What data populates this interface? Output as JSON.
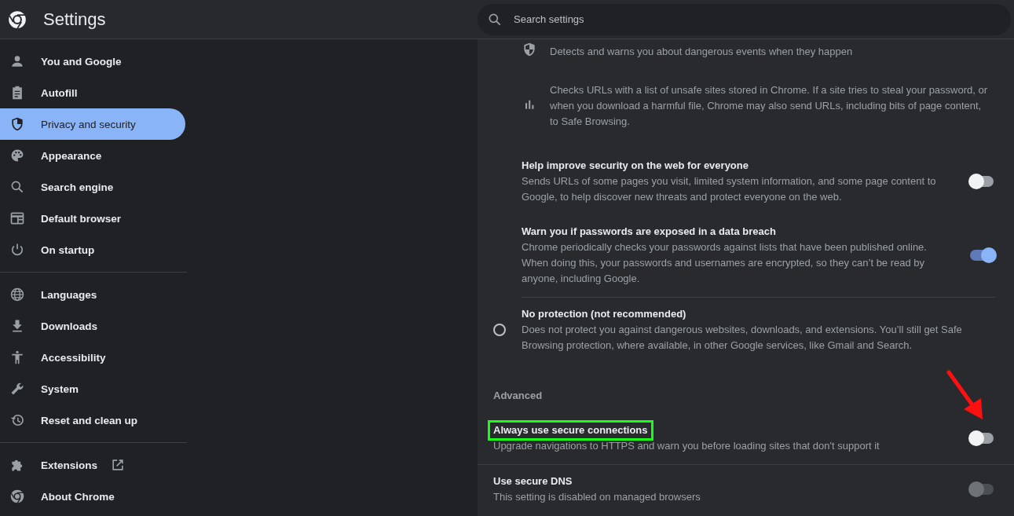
{
  "header": {
    "title": "Settings",
    "search": {
      "placeholder": "Search settings"
    }
  },
  "sidebar": {
    "groups": [
      [
        {
          "label": "You and Google",
          "selected": false
        },
        {
          "label": "Autofill",
          "selected": false
        },
        {
          "label": "Privacy and security",
          "selected": true
        },
        {
          "label": "Appearance",
          "selected": false
        },
        {
          "label": "Search engine",
          "selected": false
        },
        {
          "label": "Default browser",
          "selected": false
        },
        {
          "label": "On startup",
          "selected": false
        }
      ],
      [
        {
          "label": "Languages",
          "selected": false
        },
        {
          "label": "Downloads",
          "selected": false
        },
        {
          "label": "Accessibility",
          "selected": false
        },
        {
          "label": "System",
          "selected": false
        },
        {
          "label": "Reset and clean up",
          "selected": false
        }
      ],
      [
        {
          "label": "Extensions",
          "selected": false,
          "external": true
        },
        {
          "label": "About Chrome",
          "selected": false,
          "external": false
        }
      ]
    ]
  },
  "content": {
    "bullets": [
      {
        "text": "Detects and warns you about dangerous events when they happen"
      },
      {
        "text": "Checks URLs with a list of unsafe sites stored in Chrome. If a site tries to steal your password, or when you download a harmful file, Chrome may also send URLs, including bits of page content, to Safe Browsing."
      }
    ],
    "sub_options": [
      {
        "title": "Help improve security on the web for everyone",
        "description": "Sends URLs of some pages you visit, limited system information, and some page content to Google, to help discover new threats and protect everyone on the web.",
        "on": false
      },
      {
        "title": "Warn you if passwords are exposed in a data breach",
        "description": "Chrome periodically checks your passwords against lists that have been published online. When doing this, your passwords and usernames are encrypted, so they can’t be read by anyone, including Google.",
        "on": true
      }
    ],
    "no_protection": {
      "title": "No protection (not recommended)",
      "description": "Does not protect you against dangerous websites, downloads, and extensions. You’ll still get Safe Browsing protection, where available, in other Google services, like Gmail and Search.",
      "selected": false
    },
    "advanced": {
      "heading": "Advanced",
      "options": [
        {
          "title": "Always use secure connections",
          "description": "Upgrade navigations to HTTPS and warn you before loading sites that don't support it",
          "on": false,
          "disabled": false,
          "highlighted": true
        },
        {
          "title": "Use secure DNS",
          "description": "This setting is disabled on managed browsers",
          "on": false,
          "disabled": true,
          "highlighted": false
        }
      ]
    }
  }
}
